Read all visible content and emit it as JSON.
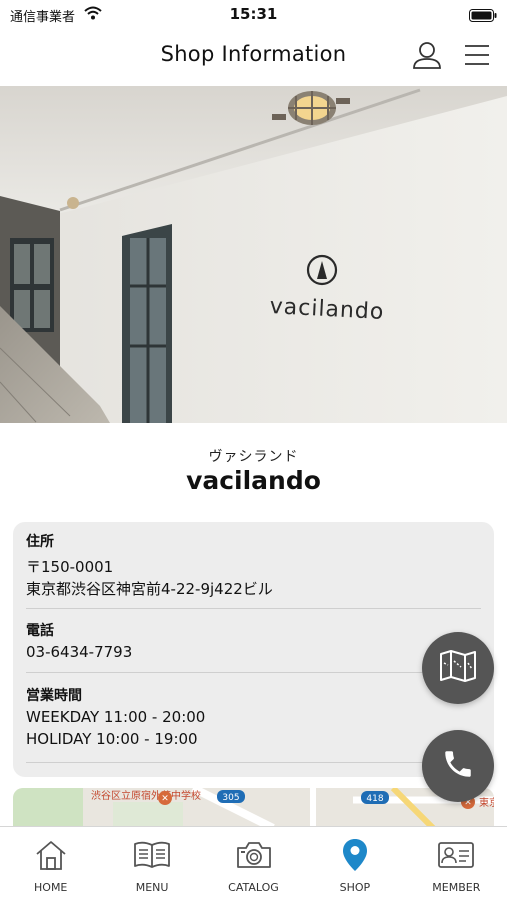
{
  "status_bar": {
    "carrier": "通信事業者",
    "time": "15:31",
    "icons": [
      "wifi-icon",
      "battery-icon"
    ]
  },
  "header": {
    "title": "Shop Information",
    "profile_icon": "user-icon",
    "menu_icon": "hamburger-menu-icon"
  },
  "hero": {
    "logo_text": "vacilando"
  },
  "shop": {
    "name_kana": "ヴァシランド",
    "name": "vacilando"
  },
  "info": {
    "address": {
      "label": "住所",
      "postal": "〒150-0001",
      "line": "東京都渋谷区神宮前4-22-9j422ビル"
    },
    "phone": {
      "label": "電話",
      "number": "03-6434-7793"
    },
    "hours": {
      "label": "営業時間",
      "weekday": "WEEKDAY 11:00 - 20:00",
      "holiday": "HOLIDAY 10:00 - 19:00"
    }
  },
  "map": {
    "label_school": "渋谷区立原宿外苑中学校",
    "route_305": "305",
    "route_418": "418",
    "label_right": "東京"
  },
  "fab": {
    "map_icon": "map-icon",
    "phone_icon": "phone-icon"
  },
  "tabs": [
    {
      "label": "HOME",
      "icon": "home-icon"
    },
    {
      "label": "MENU",
      "icon": "book-icon"
    },
    {
      "label": "CATALOG",
      "icon": "camera-icon"
    },
    {
      "label": "SHOP",
      "icon": "location-pin-icon"
    },
    {
      "label": "MEMBER",
      "icon": "member-card-icon"
    }
  ],
  "colors": {
    "accent": "#1e88c9",
    "fab": "#555555",
    "card": "#ededed"
  }
}
